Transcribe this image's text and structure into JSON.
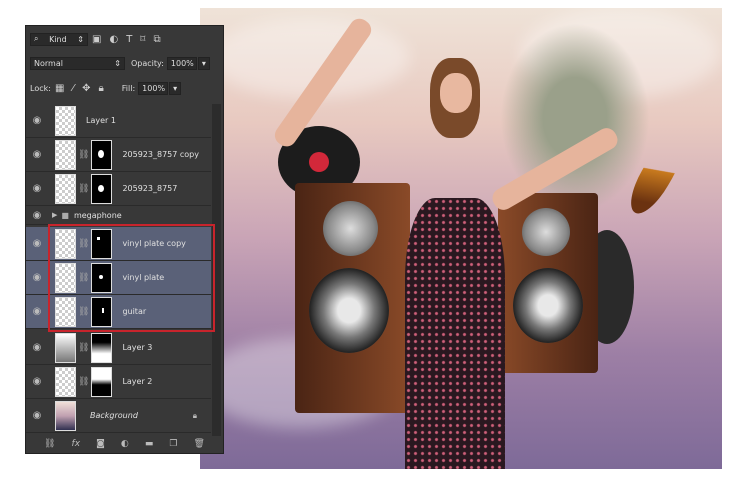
{
  "layers_panel": {
    "filter": {
      "label": "Kind",
      "icons": [
        "image-filter-icon",
        "adjustment-filter-icon",
        "type-filter-icon",
        "shape-filter-icon",
        "smart-object-filter-icon"
      ]
    },
    "blend_mode": "Normal",
    "opacity_label": "Opacity:",
    "opacity_value": "100%",
    "lock_label": "Lock:",
    "fill_label": "Fill:",
    "fill_value": "100%",
    "layers": [
      {
        "name": "Layer 1",
        "mask": false,
        "selected": false
      },
      {
        "name": "205923_8757 copy",
        "mask": true,
        "selected": false
      },
      {
        "name": "205923_8757",
        "mask": true,
        "selected": false
      },
      {
        "name": "megaphone",
        "group": true,
        "selected": false
      },
      {
        "name": "vinyl plate copy",
        "mask": true,
        "selected": true
      },
      {
        "name": "vinyl plate",
        "mask": true,
        "selected": true
      },
      {
        "name": "guitar",
        "mask": true,
        "selected": true
      },
      {
        "name": "Layer 3",
        "mask": true,
        "selected": false
      },
      {
        "name": "Layer 2",
        "mask": true,
        "selected": false
      },
      {
        "name": "Background",
        "locked": true,
        "selected": false
      }
    ],
    "footer_icons": [
      "link-icon",
      "fx-icon",
      "mask-icon",
      "adjustment-icon",
      "folder-icon",
      "new-layer-icon",
      "trash-icon"
    ]
  },
  "colors": {
    "selection_highlight": "#c8242c",
    "selected_row": "#5a6178",
    "panel_bg": "#383838"
  }
}
